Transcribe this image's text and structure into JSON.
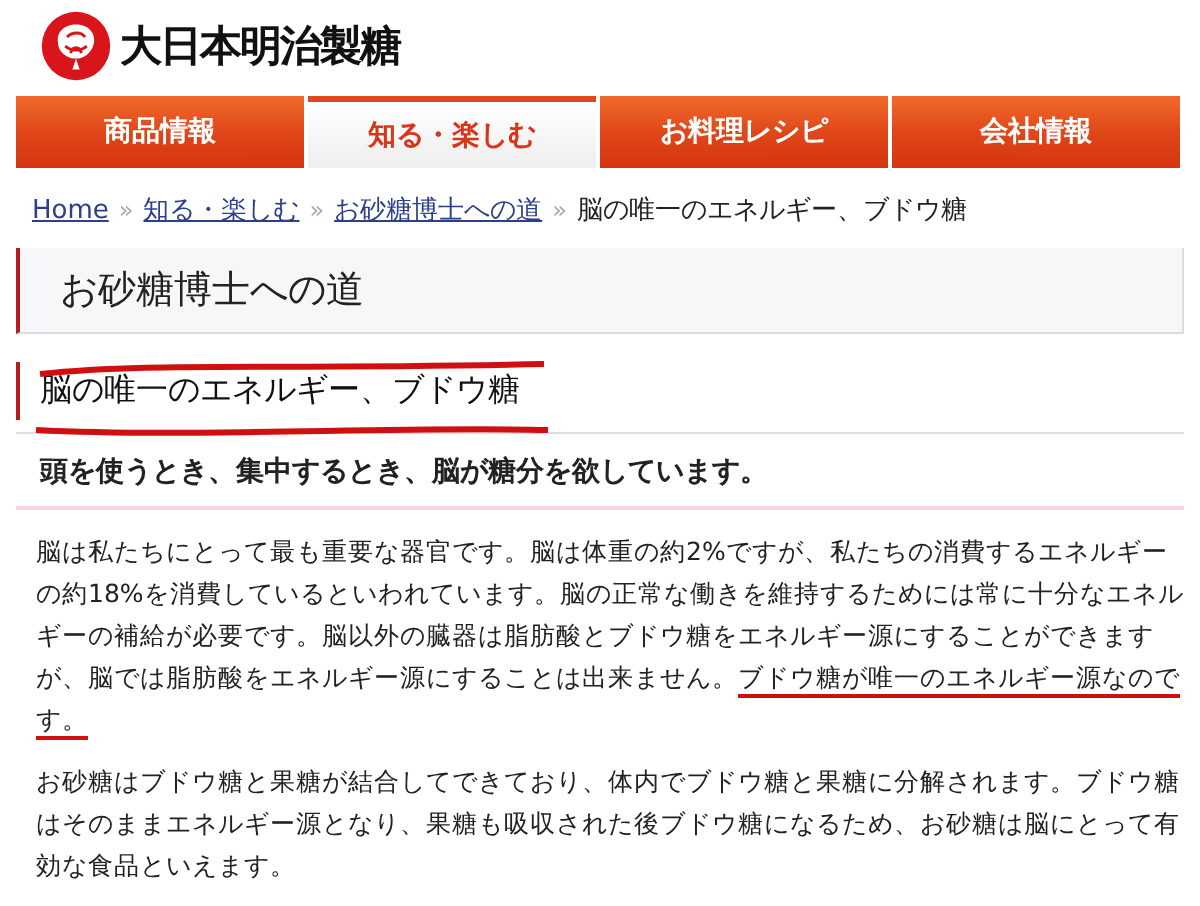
{
  "header": {
    "logo_text": "大日本明治製糖"
  },
  "nav": {
    "tabs": [
      {
        "label": "商品情報",
        "selected": false
      },
      {
        "label": "知る・楽しむ",
        "selected": true
      },
      {
        "label": "お料理レシピ",
        "selected": false
      },
      {
        "label": "会社情報",
        "selected": false
      }
    ]
  },
  "breadcrumb": {
    "links": [
      "Home",
      "知る・楽しむ",
      "お砂糖博士への道"
    ],
    "separator": "»",
    "current": "脳の唯一のエネルギー、ブドウ糖"
  },
  "section_title": "お砂糖博士への道",
  "article": {
    "heading": {
      "text": "脳の唯一のエネルギー、ブドウ糖",
      "circled": true
    },
    "lead": "頭を使うとき、集中するとき、脳が糖分を欲しています。",
    "paragraphs": [
      [
        {
          "text": "脳は私たちにとって最も重要な器官です。脳は体重の約2%ですが、私たちの消費するエネルギーの約18%を消費しているといわれています。脳の正常な働きを維持するためには常に十分なエネルギーの補給が必要です。脳以外の臓器は脂肪酸とブドウ糖をエネルギー源にすることができますが、脳では脂肪酸をエネルギー源にすることは出来ません。",
          "underlined": false
        },
        {
          "text": "ブドウ糖が唯一のエネルギー源なのです。",
          "underlined": true
        }
      ],
      [
        {
          "text": "お砂糖はブドウ糖と果糖が結合してできており、体内でブドウ糖と果糖に分解されます。ブドウ糖はそのままエネルギー源となり、果糖も吸収された後ブドウ糖になるため、お砂糖は脳にとって有効な食品といえます。",
          "underlined": false
        }
      ]
    ]
  }
}
